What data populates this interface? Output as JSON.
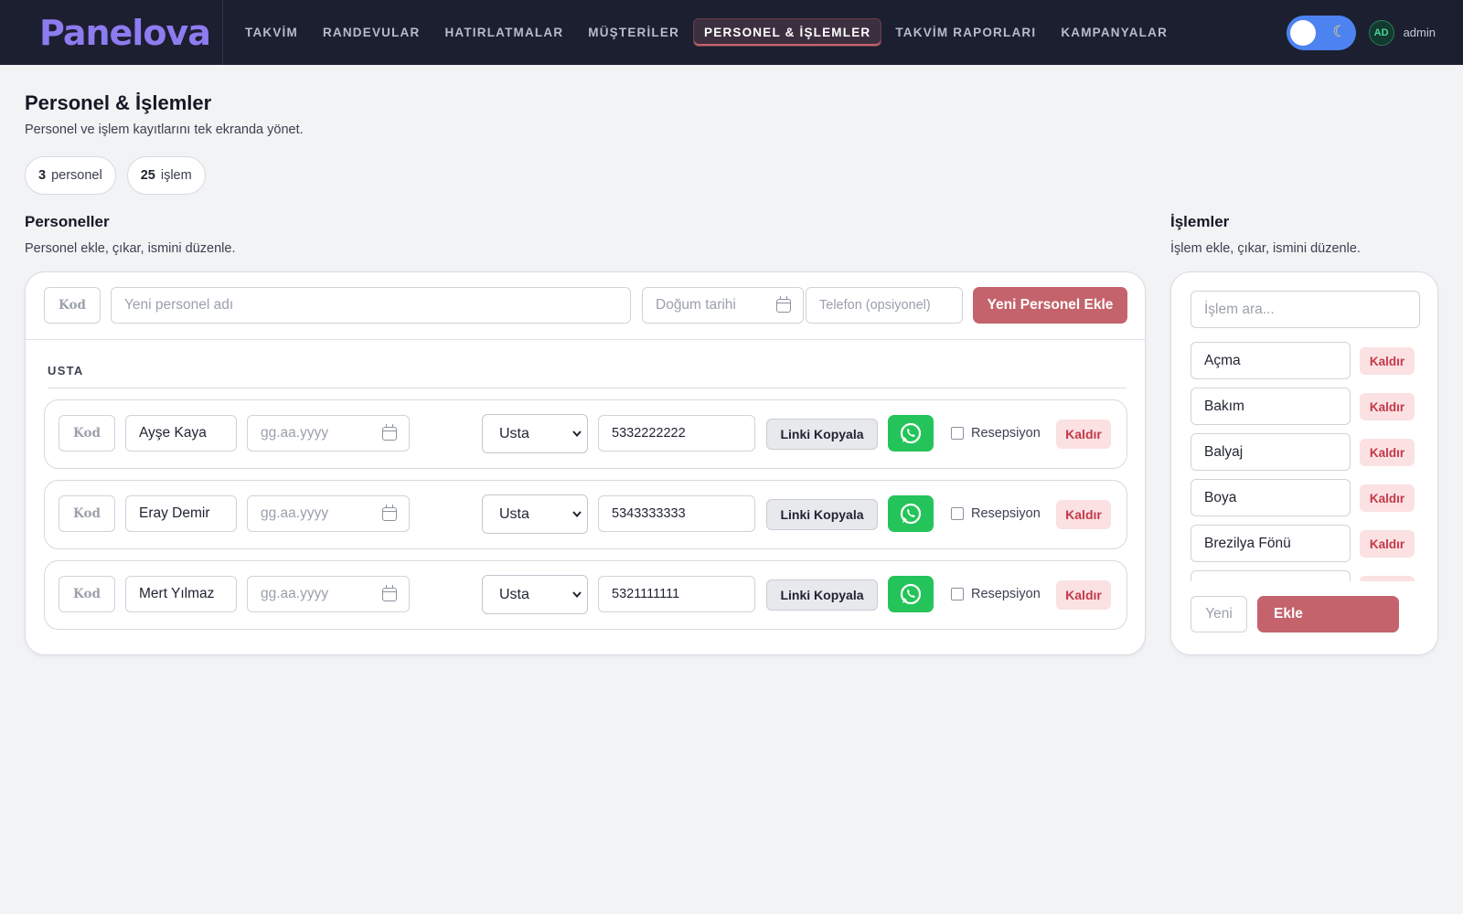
{
  "brand": "Panelova",
  "nav": {
    "items": [
      "TAKVİM",
      "RANDEVULAR",
      "HATIRLATMALAR",
      "MÜŞTERİLER",
      "PERSONEL & İŞLEMLER",
      "TAKVİM RAPORLARI",
      "KAMPANYALAR"
    ],
    "active_index": 4
  },
  "theme_toggle": {
    "icon": "moon-icon",
    "glyph": "☾"
  },
  "user": {
    "initials": "AD",
    "name": "admin"
  },
  "page": {
    "title": "Personel & İşlemler",
    "subtitle": "Personel ve işlem kayıtlarını tek ekranda yönet."
  },
  "stats": {
    "staff_count": "3",
    "staff_label": "personel",
    "service_count": "25",
    "service_label": "işlem"
  },
  "staff_section": {
    "title": "Personeller",
    "subtitle": "Personel ekle, çıkar, ismini düzenle.",
    "add_form": {
      "code_placeholder": "Kod",
      "name_placeholder": "Yeni personel adı",
      "birth_placeholder": "Doğum tarihi",
      "phone_placeholder": "Telefon (opsiyonel)",
      "add_button": "Yeni Personel Ekle"
    },
    "group_label": "USTA",
    "rows": [
      {
        "code": "Kod",
        "name": "Ayşe Kaya",
        "birth_placeholder": "gg.aa.yyyy",
        "role": "Usta",
        "phone": "5332222222",
        "copy_label": "Linki Kopyala",
        "reception_label": "Resepsiyon",
        "reception_checked": false,
        "remove_label": "Kaldır"
      },
      {
        "code": "Kod",
        "name": "Eray Demir",
        "birth_placeholder": "gg.aa.yyyy",
        "role": "Usta",
        "phone": "5343333333",
        "copy_label": "Linki Kopyala",
        "reception_label": "Resepsiyon",
        "reception_checked": false,
        "remove_label": "Kaldır"
      },
      {
        "code": "Kod",
        "name": "Mert Yılmaz",
        "birth_placeholder": "gg.aa.yyyy",
        "role": "Usta",
        "phone": "5321111111",
        "copy_label": "Linki Kopyala",
        "reception_label": "Resepsiyon",
        "reception_checked": false,
        "remove_label": "Kaldır"
      }
    ]
  },
  "services_section": {
    "title": "İşlemler",
    "subtitle": "İşlem ekle, çıkar, ismini düzenle.",
    "search_placeholder": "İşlem ara...",
    "items": [
      {
        "name": "Açma",
        "remove_label": "Kaldır"
      },
      {
        "name": "Bakım",
        "remove_label": "Kaldır"
      },
      {
        "name": "Balyaj",
        "remove_label": "Kaldır"
      },
      {
        "name": "Boya",
        "remove_label": "Kaldır"
      },
      {
        "name": "Brezilya Fönü",
        "remove_label": "Kaldır"
      },
      {
        "name": "",
        "remove_label": ""
      }
    ],
    "new_placeholder": "Yeni",
    "add_button": "Ekle"
  },
  "colors": {
    "accent": "#c4636b",
    "topbar": "#1b1f30",
    "brand": "#8d7cf0",
    "whatsapp": "#25c45a",
    "remove_bg": "#fbe1e2",
    "remove_text": "#c3394a"
  },
  "icons": {
    "calendar": "calendar-icon",
    "whatsapp": "whatsapp-icon",
    "select": "chevron-down-icon"
  }
}
